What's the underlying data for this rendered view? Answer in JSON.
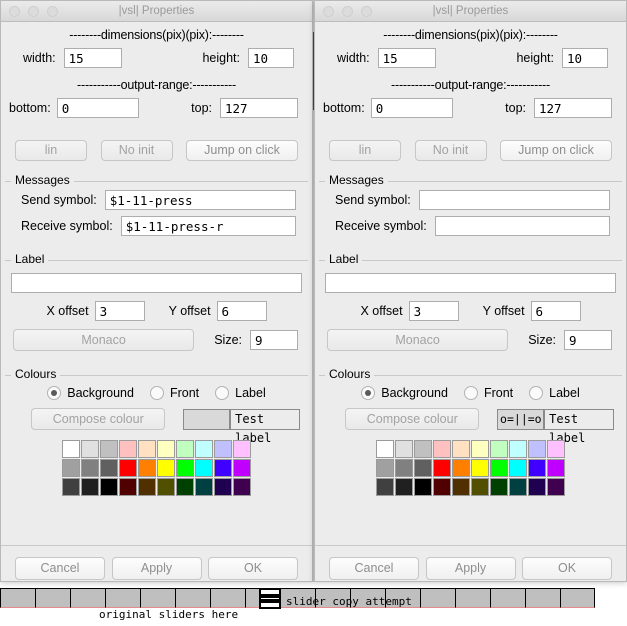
{
  "canvas": {
    "original_sliders_label": "original sliders here",
    "slider_copy_label": "slider copy attempt",
    "slider_cell_count": 17
  },
  "window_title": "|vsl| Properties",
  "common": {
    "dimensions_header": "--------dimensions(pix)(pix):--------",
    "output_range_header": "-----------output-range:-----------",
    "width_label": "width:",
    "height_label": "height:",
    "bottom_label": "bottom:",
    "top_label": "top:",
    "btn_lin": "lin",
    "btn_no_init": "No init",
    "btn_jump_on_click": "Jump on click",
    "messages_group": "Messages",
    "send_symbol_label": "Send symbol:",
    "receive_symbol_label": "Receive symbol:",
    "label_group": "Label",
    "x_offset_label": "X offset",
    "y_offset_label": "Y offset",
    "font_button": "Monaco",
    "size_label": "Size:",
    "colours_group": "Colours",
    "radio_background": "Background",
    "radio_front": "Front",
    "radio_label": "Label",
    "compose_colour": "Compose colour",
    "test_label": "Test label",
    "cancel": "Cancel",
    "apply": "Apply",
    "ok": "OK"
  },
  "windows": [
    {
      "id": "left",
      "width_value": "15",
      "height_value": "10",
      "bottom_value": "0",
      "top_value": "127",
      "send_symbol_value": "$1-11-press",
      "receive_symbol_value": "$1-11-press-r",
      "label_value": "",
      "x_offset_value": "3",
      "y_offset_value": "6",
      "size_value": "9",
      "preview_text": "",
      "selected_colour_target": "Background"
    },
    {
      "id": "right",
      "width_value": "15",
      "height_value": "10",
      "bottom_value": "0",
      "top_value": "127",
      "send_symbol_value": "",
      "receive_symbol_value": "",
      "label_value": "",
      "x_offset_value": "3",
      "y_offset_value": "6",
      "size_value": "9",
      "preview_text": "o=||=o",
      "selected_colour_target": "Background"
    }
  ],
  "palette": {
    "row1": [
      "#ffffff",
      "#e0e0e0",
      "#c0c0c0",
      "#ffc0c0",
      "#ffe0c0",
      "#ffffc0",
      "#c0ffc0",
      "#c0ffff",
      "#c0c0ff",
      "#ffc0ff"
    ],
    "row2": [
      "#a0a0a0",
      "#808080",
      "#606060",
      "#ff0000",
      "#ff8000",
      "#ffff00",
      "#00ff00",
      "#00ffff",
      "#4000ff",
      "#bf00ff"
    ],
    "row3": [
      "#404040",
      "#202020",
      "#000000",
      "#500000",
      "#503000",
      "#505000",
      "#004000",
      "#004040",
      "#200050",
      "#3f0050"
    ]
  },
  "colors": {
    "window_bg": "#ececec",
    "titlebar": "#e3e3e3",
    "accent_blue": "#1f4fa8",
    "slider_cell": "#bfbfbf",
    "slider_underline": "#e58b8b"
  }
}
